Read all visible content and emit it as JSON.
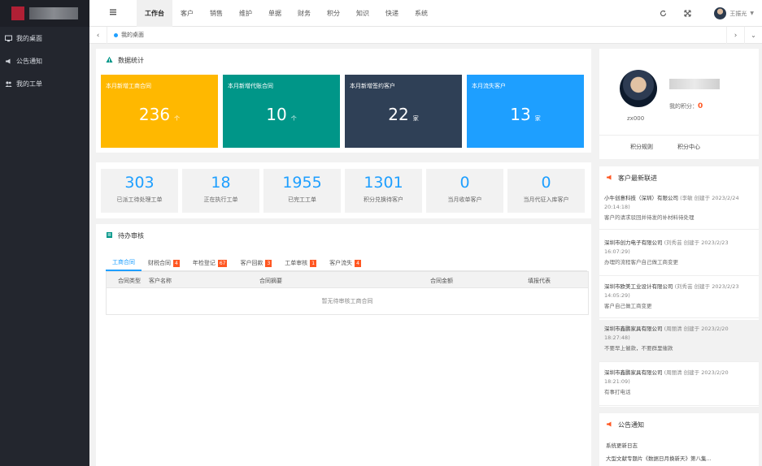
{
  "sidebar": {
    "items": [
      {
        "label": "我的桌面",
        "icon": "desktop-icon"
      },
      {
        "label": "公告通知",
        "icon": "megaphone-icon"
      },
      {
        "label": "我的工单",
        "icon": "users-icon"
      }
    ]
  },
  "topbar": {
    "menu_icon": "grid-icon",
    "nav": [
      "工作台",
      "客户",
      "销售",
      "维护",
      "单据",
      "财务",
      "积分",
      "知识",
      "快递",
      "系统"
    ],
    "active_index": 0,
    "user": "王振光"
  },
  "tabbar": {
    "current": "我的桌面"
  },
  "stats": {
    "title": "数据统计",
    "cards": [
      {
        "label": "本月新增工商合同",
        "value": "236",
        "unit": "个",
        "color": "#ffb800"
      },
      {
        "label": "本月新增代账合同",
        "value": "10",
        "unit": "个",
        "color": "#009688"
      },
      {
        "label": "本月新增签约客户",
        "value": "22",
        "unit": "家",
        "color": "#2f4056"
      },
      {
        "label": "本月流失客户",
        "value": "13",
        "unit": "家",
        "color": "#1e9fff"
      }
    ]
  },
  "counts": [
    {
      "value": "303",
      "label": "已派工待处理工单"
    },
    {
      "value": "18",
      "label": "正在执行工单"
    },
    {
      "value": "1955",
      "label": "已完工工单"
    },
    {
      "value": "1301",
      "label": "积分兑换待客户"
    },
    {
      "value": "0",
      "label": "当月收单客户"
    },
    {
      "value": "0",
      "label": "当月代征入库客户"
    }
  ],
  "pending": {
    "title": "待办审核",
    "tabs": [
      {
        "label": "工商合同",
        "badge": ""
      },
      {
        "label": "财税合同",
        "badge": "4"
      },
      {
        "label": "年检登记",
        "badge": "67"
      },
      {
        "label": "客户回款",
        "badge": "3"
      },
      {
        "label": "工单审核",
        "badge": "1"
      },
      {
        "label": "客户流失",
        "badge": "4"
      }
    ],
    "columns": [
      "合同类型",
      "客户名称",
      "合同摘要",
      "合同金额",
      "填报代表"
    ],
    "empty_text": "暂无待审核工商合同"
  },
  "profile": {
    "username": "zx000",
    "score_label": "我的积分：",
    "score": "0",
    "links": [
      "积分规则",
      "积分中心"
    ]
  },
  "news": {
    "title": "客户最新联进",
    "items": [
      {
        "company": "小牛创意科技（深圳）有限公司",
        "creator": "(李敏 创建于 2023/2/24 20:14:18)",
        "note": "客户的请求驳回并待发的补材料待处理"
      },
      {
        "company": "深圳市创力电子有限公司",
        "creator": "(刘秀芸 创建于 2023/2/23 16:07:29)",
        "note": "办理的流程客户自己做工商变更"
      },
      {
        "company": "深圳市欧美工业设计有限公司",
        "creator": "(刘秀芸 创建于 2023/2/23 14:05:29)",
        "note": "客户自己做工商变更"
      },
      {
        "company": "深圳市鑫鹏家具有限公司",
        "creator": "(周丽清 创建于 2023/2/20 18:27:48)",
        "note": "不要早上催款，不要群里催款"
      },
      {
        "company": "深圳市鑫鹏家具有限公司",
        "creator": "(周丽清 创建于 2023/2/20 18:21:09)",
        "note": "有事打电话"
      }
    ]
  },
  "notice": {
    "title": "公告通知",
    "items": [
      "系统更新日志",
      "大型文献专题片《数据日月换新天》第八集..."
    ]
  }
}
